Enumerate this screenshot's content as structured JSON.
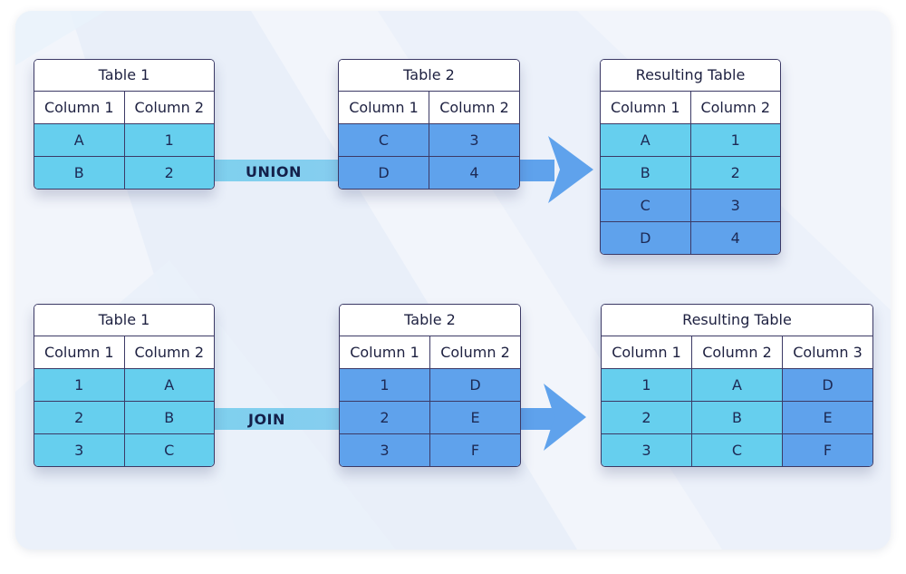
{
  "colors": {
    "light_cell": "#66cfee",
    "dark_cell": "#5fa2ec",
    "border": "#3c3a66",
    "arrow": "#5fa2ec",
    "band": "#7fd0ee",
    "label_text": "#14204a"
  },
  "union": {
    "label": "UNION",
    "table1": {
      "title": "Table 1",
      "headers": [
        "Column 1",
        "Column 2"
      ],
      "rows": [
        [
          "A",
          "1"
        ],
        [
          "B",
          "2"
        ]
      ]
    },
    "table2": {
      "title": "Table 2",
      "headers": [
        "Column 1",
        "Column 2"
      ],
      "rows": [
        [
          "C",
          "3"
        ],
        [
          "D",
          "4"
        ]
      ]
    },
    "result": {
      "title": "Resulting Table",
      "headers": [
        "Column 1",
        "Column 2"
      ],
      "rows": [
        [
          "A",
          "1"
        ],
        [
          "B",
          "2"
        ],
        [
          "C",
          "3"
        ],
        [
          "D",
          "4"
        ]
      ]
    }
  },
  "join": {
    "label": "JOIN",
    "table1": {
      "title": "Table 1",
      "headers": [
        "Column 1",
        "Column 2"
      ],
      "rows": [
        [
          "1",
          "A"
        ],
        [
          "2",
          "B"
        ],
        [
          "3",
          "C"
        ]
      ]
    },
    "table2": {
      "title": "Table 2",
      "headers": [
        "Column 1",
        "Column 2"
      ],
      "rows": [
        [
          "1",
          "D"
        ],
        [
          "2",
          "E"
        ],
        [
          "3",
          "F"
        ]
      ]
    },
    "result": {
      "title": "Resulting Table",
      "headers": [
        "Column 1",
        "Column 2",
        "Column 3"
      ],
      "rows": [
        [
          "1",
          "A",
          "D"
        ],
        [
          "2",
          "B",
          "E"
        ],
        [
          "3",
          "C",
          "F"
        ]
      ]
    }
  }
}
